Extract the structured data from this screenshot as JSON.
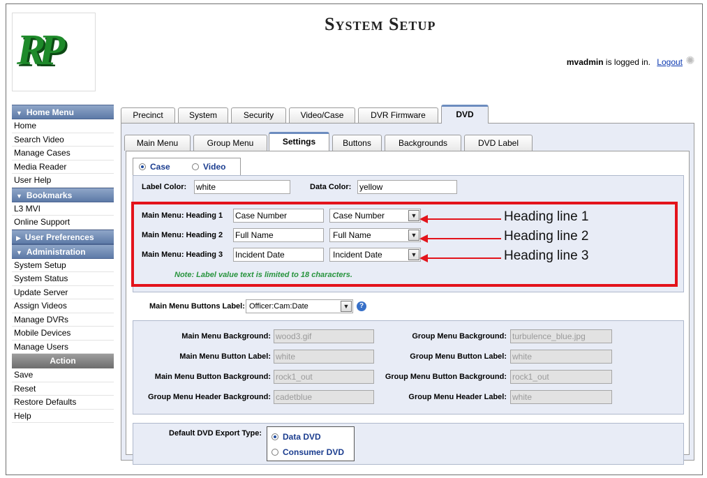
{
  "header": {
    "logo_text": "RP",
    "title": "System Setup",
    "user": "mvadmin",
    "logged_in_text": "is logged in.",
    "logout_label": "Logout"
  },
  "sidebar": {
    "home_menu": {
      "title": "Home Menu",
      "items": [
        "Home",
        "Search Video",
        "Manage Cases",
        "Media Reader",
        "User Help"
      ]
    },
    "bookmarks": {
      "title": "Bookmarks",
      "items": [
        "L3 MVI",
        "Online Support"
      ]
    },
    "user_preferences": {
      "title": "User Preferences"
    },
    "administration": {
      "title": "Administration",
      "items": [
        "System Setup",
        "System Status",
        "Update Server",
        "Assign Videos",
        "Manage DVRs",
        "Mobile Devices",
        "Manage Users"
      ]
    },
    "action": {
      "title": "Action",
      "items": [
        "Save",
        "Reset",
        "Restore Defaults",
        "Help"
      ]
    }
  },
  "tabs": [
    "Precinct",
    "System",
    "Security",
    "Video/Case",
    "DVR Firmware",
    "DVD"
  ],
  "active_tab": "DVD",
  "subtabs": [
    "Main Menu",
    "Group Menu",
    "Settings",
    "Buttons",
    "Backgrounds",
    "DVD Label"
  ],
  "active_subtab": "Settings",
  "mode": {
    "case_label": "Case",
    "video_label": "Video",
    "selected": "Case"
  },
  "colors": {
    "label_color_label": "Label Color:",
    "label_color_value": "white",
    "data_color_label": "Data Color:",
    "data_color_value": "yellow"
  },
  "headings": [
    {
      "label": "Main Menu: Heading 1",
      "text": "Case Number",
      "select": "Case Number"
    },
    {
      "label": "Main Menu: Heading 2",
      "text": "Full Name",
      "select": "Full Name"
    },
    {
      "label": "Main Menu: Heading 3",
      "text": "Incident Date",
      "select": "Incident Date"
    }
  ],
  "note": "Note: Label value text is limited to 18 characters.",
  "annotations": [
    "Heading line 1",
    "Heading line 2",
    "Heading line 3"
  ],
  "buttons_label": {
    "label": "Main Menu Buttons Label:",
    "value": "Officer:Cam:Date"
  },
  "backgrounds": {
    "main_menu_background_label": "Main Menu Background:",
    "main_menu_background": "wood3.gif",
    "group_menu_background_label": "Group Menu Background:",
    "group_menu_background": "turbulence_blue.jpg",
    "main_menu_button_label_label": "Main Menu Button Label:",
    "main_menu_button_label": "white",
    "group_menu_button_label_label": "Group Menu Button Label:",
    "group_menu_button_label": "white",
    "main_menu_button_background_label": "Main Menu Button Background:",
    "main_menu_button_background": "rock1_out",
    "group_menu_button_background_label": "Group Menu Button Background:",
    "group_menu_button_background": "rock1_out",
    "group_menu_header_background_label": "Group Menu Header Background:",
    "group_menu_header_background": "cadetblue",
    "group_menu_header_label_label": "Group Menu Header Label:",
    "group_menu_header_label": "white"
  },
  "export": {
    "label": "Default DVD Export Type:",
    "options": [
      "Data DVD",
      "Consumer DVD"
    ],
    "selected": "Data DVD"
  },
  "accent_colors": {
    "highlight": "#e3131b",
    "note": "#28943e",
    "tab_accent": "#6c8cbf",
    "panel": "#e8ecf6"
  }
}
